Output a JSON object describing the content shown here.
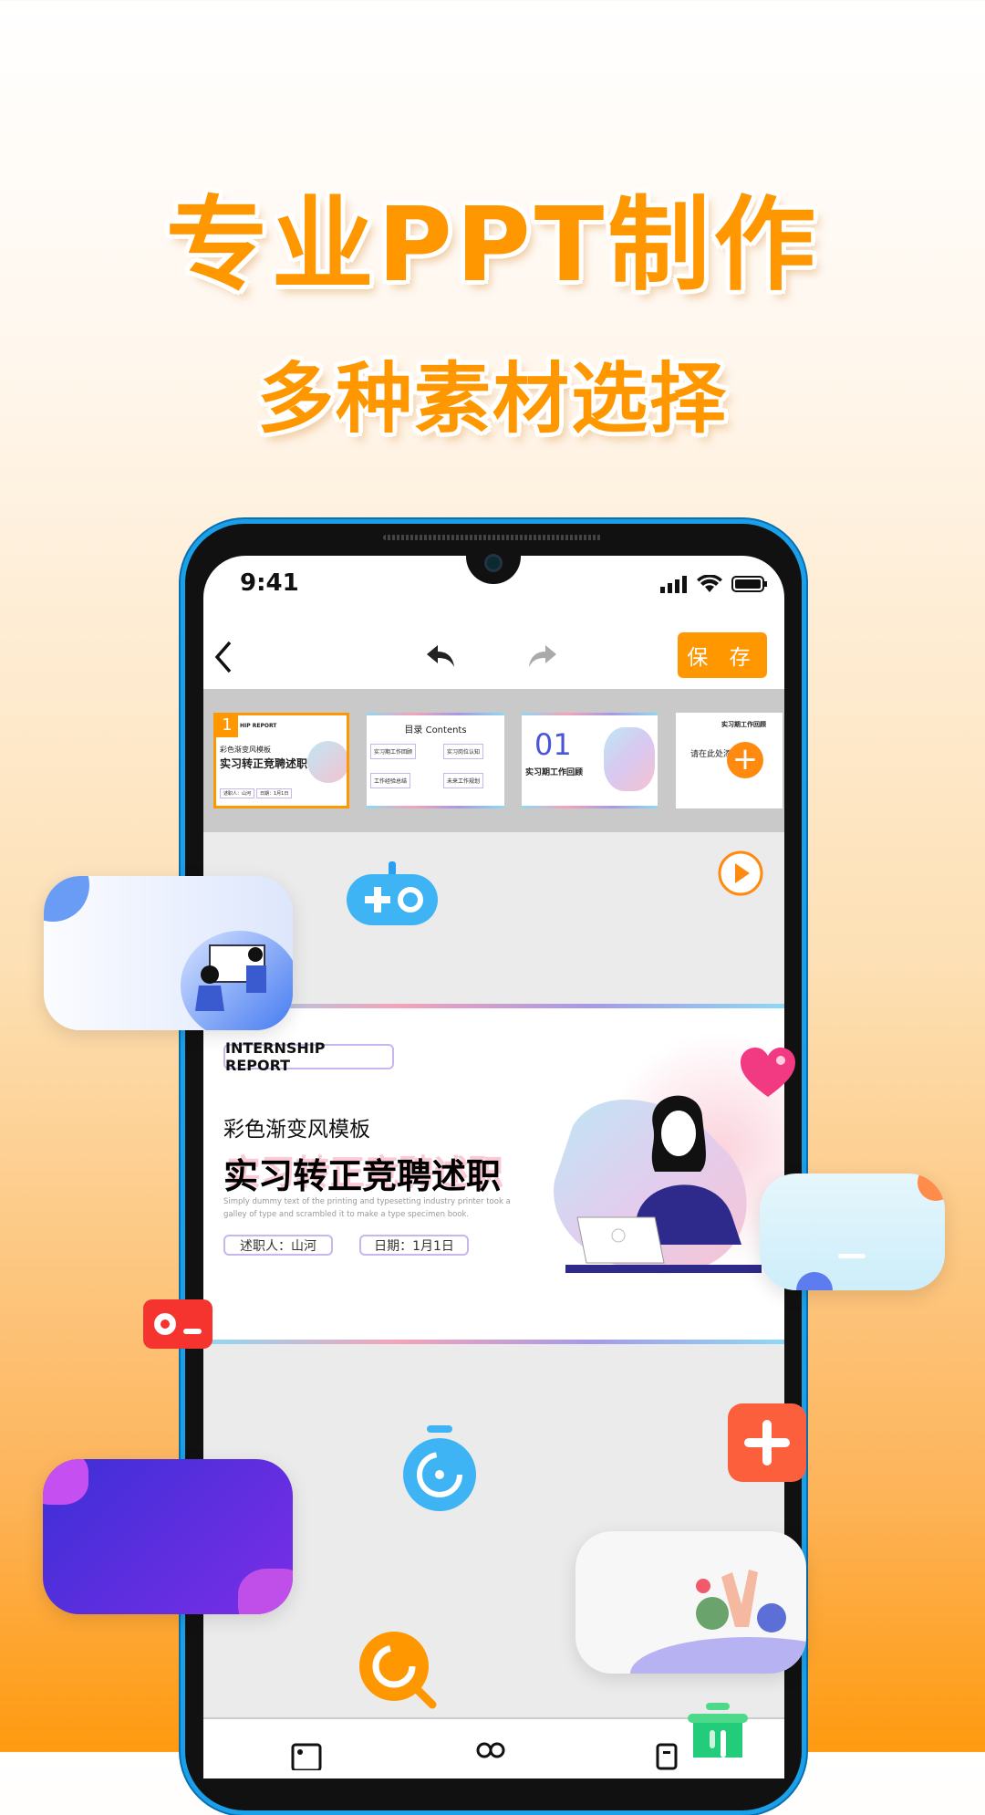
{
  "hero": {
    "title": "专业PPT制作",
    "subtitle": "多种素材选择"
  },
  "status_bar": {
    "time": "9:41"
  },
  "toolbar": {
    "back_icon": "chevron-left-icon",
    "undo_icon": "undo-icon",
    "redo_icon": "redo-icon",
    "save_label": "保 存"
  },
  "thumbnails": [
    {
      "number": "1",
      "header": "HIP REPORT",
      "subtitle": "彩色渐变风模板",
      "title": "实习转正竞聘述职",
      "chip1": "述职人：山河",
      "chip2": "日期：1月1日",
      "selected": true
    },
    {
      "title": "目录 Contents",
      "items": [
        "实习期工作回顾",
        "实习岗位认知",
        "工作经验总结",
        "未来工作规划"
      ]
    },
    {
      "number": "01",
      "title": "实习期工作回顾"
    },
    {
      "title": "实习期工作回顾",
      "placeholder": "请在此处添加"
    }
  ],
  "slide": {
    "tag": "INTERNSHIP REPORT",
    "subtitle": "彩色渐变风模板",
    "title": "实习转正竞聘述职",
    "description": "Simply dummy text of the printing and typesetting industry printer took a galley of type and scrambled it to make a type specimen book.",
    "presenter": "述职人：山河",
    "date": "日期：1月1日"
  },
  "colors": {
    "accent": "#ff9800",
    "strip": "#c9c9c9",
    "canvas": "#ebebeb"
  }
}
